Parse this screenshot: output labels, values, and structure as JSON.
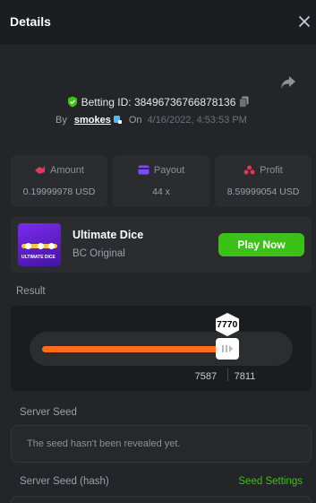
{
  "header": {
    "title": "Details"
  },
  "bet": {
    "id_label": "Betting ID: 38496736766878136",
    "by": "By",
    "user": "smokes",
    "on": "On",
    "date": "4/16/2022, 4:53:53 PM"
  },
  "stats": {
    "amount_label": "Amount",
    "amount_value": "0.19999978 USD",
    "payout_label": "Payout",
    "payout_value": "44 x",
    "profit_label": "Profit",
    "profit_value": "8.59999054 USD"
  },
  "game": {
    "name": "Ultimate Dice",
    "provider": "BC Original",
    "play_label": "Play Now",
    "thumb_text": "ULTIMATE DICE"
  },
  "result": {
    "label": "Result",
    "value": "7770",
    "range_low": "7587",
    "range_high": "7811",
    "position_fraction": 0.777
  },
  "server_seed": {
    "label": "Server Seed",
    "message": "The seed hasn't been revealed yet."
  },
  "server_seed_hash": {
    "label": "Server Seed (hash)",
    "settings_label": "Seed Settings"
  },
  "colors": {
    "accent_green": "#3bc117",
    "slider_orange": "#ff6a1e",
    "panel": "#232528"
  },
  "icons": [
    "close-icon",
    "share-icon",
    "shield-check-icon",
    "copy-icon",
    "amount-icon",
    "payout-icon",
    "profit-icon",
    "slider-handle-icon"
  ]
}
